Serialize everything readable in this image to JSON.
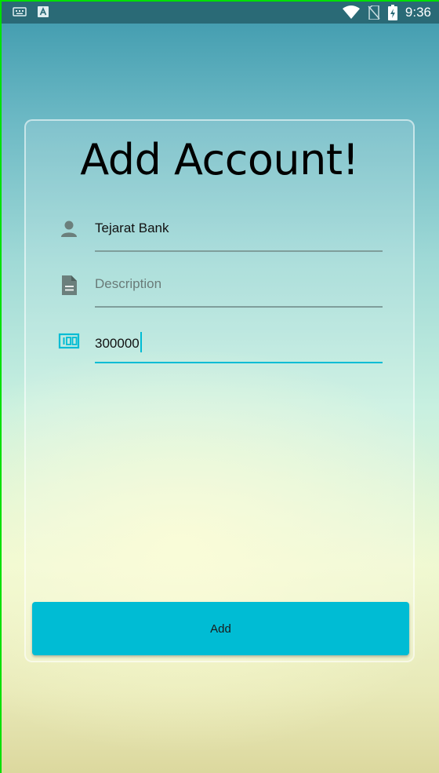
{
  "status_bar": {
    "time": "9:36",
    "icons": [
      "keyboard-icon",
      "a-notification-icon",
      "wifi-icon",
      "no-sim-icon",
      "battery-icon"
    ]
  },
  "form": {
    "title": "Add Account!",
    "fields": [
      {
        "icon": "person-icon",
        "value": "Tejarat Bank",
        "placeholder": ""
      },
      {
        "icon": "description-icon",
        "value": "",
        "placeholder": "Description"
      },
      {
        "icon": "money-icon",
        "value": "300000",
        "placeholder": ""
      }
    ],
    "submit_label": "Add"
  },
  "colors": {
    "accent": "#00bcd4",
    "icon_gray": "#6b7f7c",
    "status_bar": "#2a6a76"
  }
}
